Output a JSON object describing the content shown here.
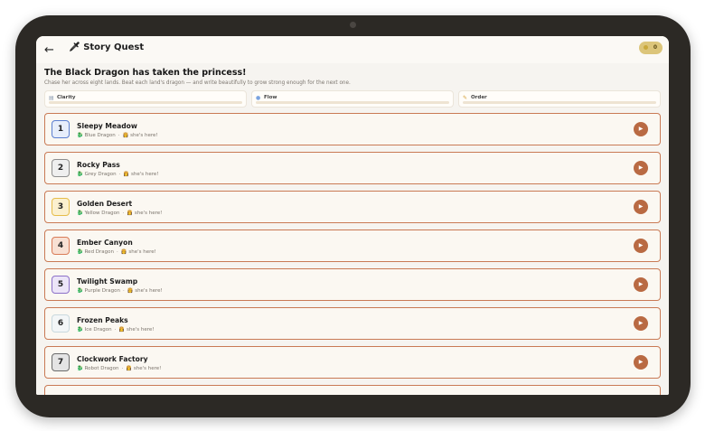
{
  "app": {
    "title": "Story Quest",
    "title_icon": "🗡",
    "coins": "0"
  },
  "story": {
    "headline": "The Black Dragon has taken the princess!",
    "subline": "Chase her across eight lands. Beat each land's dragon — and write beautifully to grow strong enough for the next one."
  },
  "stats": [
    {
      "label": "Clarity",
      "icon": "▤",
      "progress": 0
    },
    {
      "label": "Flow",
      "icon": "●",
      "progress": 0
    },
    {
      "label": "Order",
      "icon": "✎",
      "progress": 0
    }
  ],
  "levels": [
    {
      "num": "1",
      "name": "Sleepy Meadow",
      "dragon": "Blue Dragon",
      "princess": "she's here!",
      "color": "#5b7fd0",
      "bg": "#e7eefb"
    },
    {
      "num": "2",
      "name": "Rocky Pass",
      "dragon": "Grey Dragon",
      "princess": "she's here!",
      "color": "#8e8e8e",
      "bg": "#efefef"
    },
    {
      "num": "3",
      "name": "Golden Desert",
      "dragon": "Yellow Dragon",
      "princess": "she's here!",
      "color": "#e6bd4a",
      "bg": "#fbf0cf"
    },
    {
      "num": "4",
      "name": "Ember Canyon",
      "dragon": "Red Dragon",
      "princess": "she's here!",
      "color": "#d97c58",
      "bg": "#f8e0d3"
    },
    {
      "num": "5",
      "name": "Twilight Swamp",
      "dragon": "Purple Dragon",
      "princess": "she's here!",
      "color": "#8d71c9",
      "bg": "#ece5f8"
    },
    {
      "num": "6",
      "name": "Frozen Peaks",
      "dragon": "Ice Dragon",
      "princess": "she's here!",
      "color": "#c9d9de",
      "bg": "#f3f6f7"
    },
    {
      "num": "7",
      "name": "Clockwork Factory",
      "dragon": "Robot Dragon",
      "princess": "she's here!",
      "color": "#6b6b6b",
      "bg": "#e4e4e4"
    }
  ]
}
